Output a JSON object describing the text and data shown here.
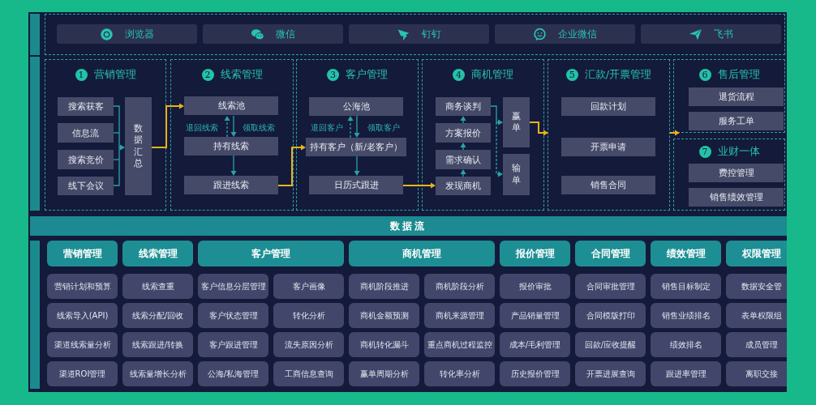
{
  "apps": [
    {
      "label": "浏览器",
      "kind": "browser"
    },
    {
      "label": "微信",
      "kind": "wechat"
    },
    {
      "label": "钉钉",
      "kind": "dingtalk"
    },
    {
      "label": "企业微信",
      "kind": "wecom"
    },
    {
      "label": "飞书",
      "kind": "feishu"
    }
  ],
  "flow": {
    "modules": [
      {
        "number": "1",
        "title": "营销管理",
        "nodes": [
          {
            "label": "搜索获客",
            "kind": "box"
          },
          {
            "label": "信息流",
            "kind": "box"
          },
          {
            "label": "搜索竞价",
            "kind": "box"
          },
          {
            "label": "线下会议",
            "kind": "box"
          },
          {
            "label": "数据汇总",
            "kind": "vertical"
          }
        ]
      },
      {
        "number": "2",
        "title": "线索管理",
        "nodes": [
          {
            "label": "线索池",
            "kind": "box"
          },
          {
            "label": "退回线索",
            "kind": "note"
          },
          {
            "label": "领取线索",
            "kind": "note"
          },
          {
            "label": "持有线索",
            "kind": "box"
          },
          {
            "label": "跟进线索",
            "kind": "box"
          }
        ]
      },
      {
        "number": "3",
        "title": "客户管理",
        "nodes": [
          {
            "label": "公海池",
            "kind": "box"
          },
          {
            "label": "退回客户",
            "kind": "note"
          },
          {
            "label": "领取客户",
            "kind": "note"
          },
          {
            "label": "持有客户（新/老客户）",
            "kind": "box"
          },
          {
            "label": "日历式跟进",
            "kind": "box"
          }
        ]
      },
      {
        "number": "4",
        "title": "商机管理",
        "nodes": [
          {
            "label": "商务谈判",
            "kind": "box"
          },
          {
            "label": "方案报价",
            "kind": "box"
          },
          {
            "label": "需求确认",
            "kind": "box"
          },
          {
            "label": "发现商机",
            "kind": "box"
          },
          {
            "label": "赢单",
            "kind": "vertical"
          },
          {
            "label": "输单",
            "kind": "vertical"
          }
        ]
      },
      {
        "number": "5",
        "title": "汇款/开票管理",
        "nodes": [
          {
            "label": "回款计划",
            "kind": "box"
          },
          {
            "label": "开票申请",
            "kind": "box"
          },
          {
            "label": "销售合同",
            "kind": "box"
          }
        ]
      },
      {
        "number": "6",
        "title": "售后管理",
        "nodes": [
          {
            "label": "退货流程",
            "kind": "box"
          },
          {
            "label": "服务工单",
            "kind": "box"
          }
        ]
      },
      {
        "number": "7",
        "title": "业财一体",
        "nodes": [
          {
            "label": "费控管理",
            "kind": "box"
          },
          {
            "label": "销售绩效管理",
            "kind": "box"
          }
        ]
      }
    ]
  },
  "data_flow": {
    "label": "数据流"
  },
  "features": [
    {
      "title": "营销管理",
      "columns": [
        [
          "营销计划和预算",
          "线索导入(API)",
          "渠道线索量分析",
          "渠道ROI管理"
        ]
      ]
    },
    {
      "title": "线索管理",
      "columns": [
        [
          "线索查重",
          "线索分配/回收",
          "线索跟进/转换",
          "线索量增长分析"
        ]
      ]
    },
    {
      "title": "客户管理",
      "columns": [
        [
          "客户信息分层管理",
          "客户状态管理",
          "客户跟进管理",
          "公海/私海管理"
        ],
        [
          "客户画像",
          "转化分析",
          "流失原因分析",
          "工商信息查询"
        ]
      ]
    },
    {
      "title": "商机管理",
      "columns": [
        [
          "商机阶段推进",
          "商机金额预测",
          "商机转化漏斗",
          "赢单周期分析"
        ],
        [
          "商机阶段分析",
          "商机来源管理",
          "重点商机过程监控",
          "转化率分析"
        ]
      ]
    },
    {
      "title": "报价管理",
      "columns": [
        [
          "报价审批",
          "产品销量管理",
          "成本/毛利管理",
          "历史报价管理"
        ]
      ]
    },
    {
      "title": "合同管理",
      "columns": [
        [
          "合同审批管理",
          "合同模版打印",
          "回款/应收提醒",
          "开票进展查询"
        ]
      ]
    },
    {
      "title": "绩效管理",
      "columns": [
        [
          "销售目标制定",
          "销售业绩排名",
          "绩效排名",
          "跟进率管理"
        ]
      ]
    },
    {
      "title": "权限管理",
      "columns": [
        [
          "数据安全管",
          "表单权限组",
          "成员管理",
          "离职交接"
        ]
      ]
    }
  ]
}
